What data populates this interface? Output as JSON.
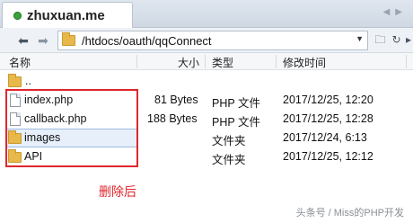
{
  "tab": {
    "title": "zhuxuan.me",
    "accent": "#3aa23a"
  },
  "toolbar": {
    "path": "/htdocs/oauth/qqConnect",
    "back_icon": "arrow-left-icon",
    "forward_icon": "arrow-right-icon"
  },
  "columns": {
    "name": "名称",
    "size": "大小",
    "type": "类型",
    "modified": "修改时间"
  },
  "rows": [
    {
      "name": "..",
      "size": "",
      "type": "",
      "modified": "",
      "icon": "folder-up-icon"
    },
    {
      "name": "index.php",
      "size": "81 Bytes",
      "type": "PHP 文件",
      "modified": "2017/12/25, 12:20",
      "icon": "file-icon"
    },
    {
      "name": "callback.php",
      "size": "188 Bytes",
      "type": "PHP 文件",
      "modified": "2017/12/25, 12:28",
      "icon": "file-icon"
    },
    {
      "name": "images",
      "size": "",
      "type": "文件夹",
      "modified": "2017/12/24, 6:13",
      "icon": "folder-icon",
      "selected": true
    },
    {
      "name": "API",
      "size": "",
      "type": "文件夹",
      "modified": "2017/12/25, 12:12",
      "icon": "folder-icon"
    }
  ],
  "annotation": {
    "text": "删除后",
    "color": "#e0262b"
  },
  "watermark": {
    "text": "头条号 / Miss的PHP开发"
  }
}
